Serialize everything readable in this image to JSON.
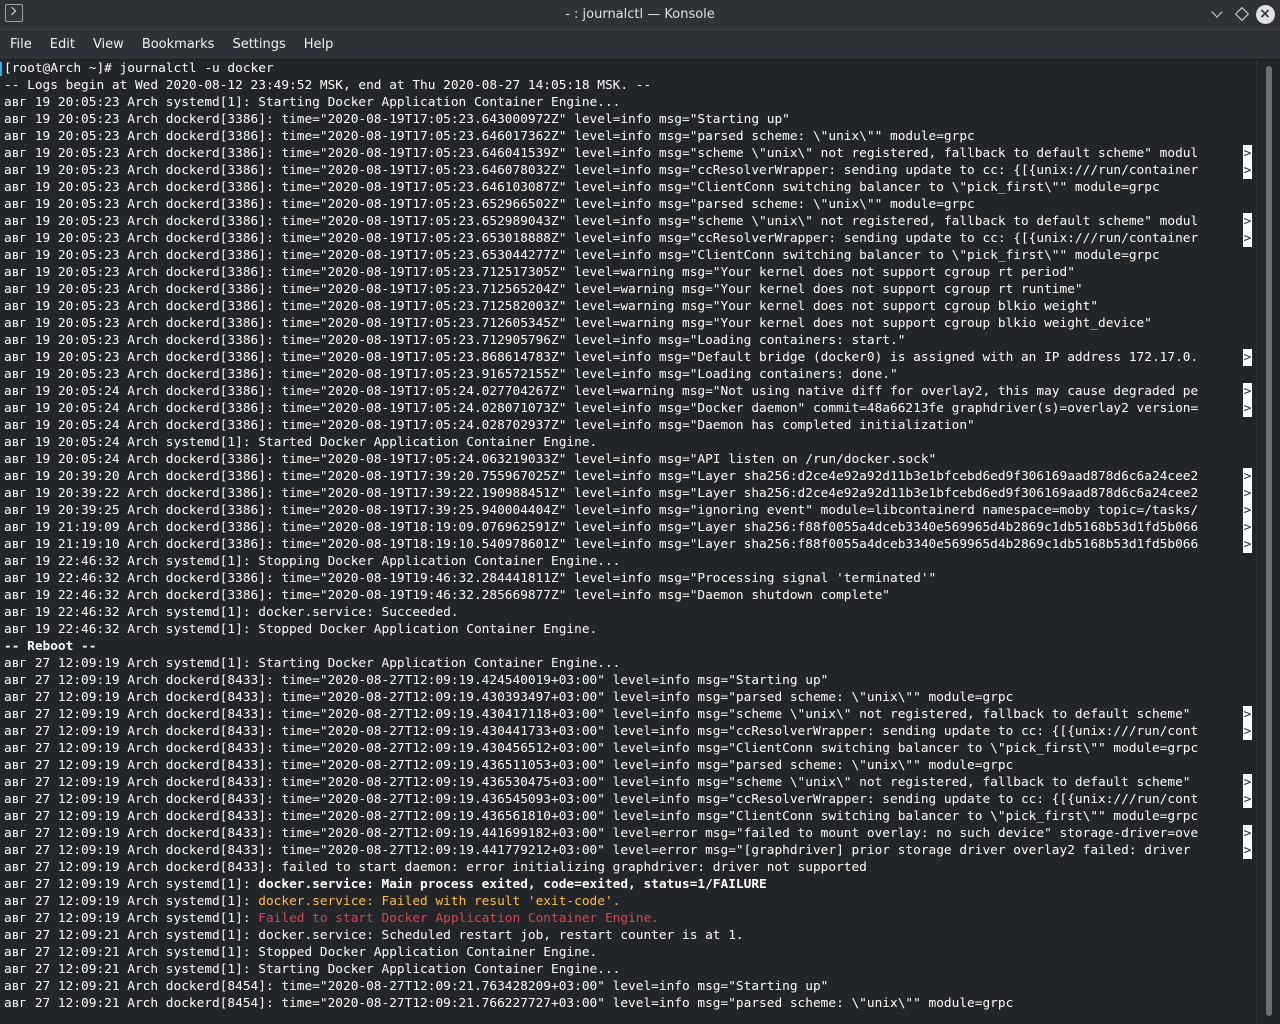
{
  "window": {
    "title": "- : journalctl — Konsole"
  },
  "menu": [
    "File",
    "Edit",
    "View",
    "Bookmarks",
    "Settings",
    "Help"
  ],
  "terminal": {
    "lines": [
      {
        "segments": [
          {
            "text": "[root@Arch ~]# journalctl -u docker"
          }
        ]
      },
      {
        "segments": [
          {
            "text": "-- Logs begin at Wed 2020-08-12 23:49:52 MSK, end at Thu 2020-08-27 14:05:18 MSK. --"
          }
        ]
      },
      {
        "segments": [
          {
            "text": "авг 19 20:05:23 Arch systemd[1]: Starting Docker Application Container Engine..."
          }
        ]
      },
      {
        "segments": [
          {
            "text": "авг 19 20:05:23 Arch dockerd[3386]: time=\"2020-08-19T17:05:23.643000972Z\" level=info msg=\"Starting up\""
          }
        ]
      },
      {
        "segments": [
          {
            "text": "авг 19 20:05:23 Arch dockerd[3386]: time=\"2020-08-19T17:05:23.646017362Z\" level=info msg=\"parsed scheme: \\\"unix\\\"\" module=grpc"
          }
        ]
      },
      {
        "segments": [
          {
            "text": "авг 19 20:05:23 Arch dockerd[3386]: time=\"2020-08-19T17:05:23.646041539Z\" level=info msg=\"scheme \\\"unix\\\" not registered, fallback to default scheme\" modul"
          }
        ],
        "truncated": true
      },
      {
        "segments": [
          {
            "text": "авг 19 20:05:23 Arch dockerd[3386]: time=\"2020-08-19T17:05:23.646078032Z\" level=info msg=\"ccResolverWrapper: sending update to cc: {[{unix:///run/container"
          }
        ],
        "truncated": true
      },
      {
        "segments": [
          {
            "text": "авг 19 20:05:23 Arch dockerd[3386]: time=\"2020-08-19T17:05:23.646103087Z\" level=info msg=\"ClientConn switching balancer to \\\"pick_first\\\"\" module=grpc"
          }
        ]
      },
      {
        "segments": [
          {
            "text": "авг 19 20:05:23 Arch dockerd[3386]: time=\"2020-08-19T17:05:23.652966502Z\" level=info msg=\"parsed scheme: \\\"unix\\\"\" module=grpc"
          }
        ]
      },
      {
        "segments": [
          {
            "text": "авг 19 20:05:23 Arch dockerd[3386]: time=\"2020-08-19T17:05:23.652989043Z\" level=info msg=\"scheme \\\"unix\\\" not registered, fallback to default scheme\" modul"
          }
        ],
        "truncated": true
      },
      {
        "segments": [
          {
            "text": "авг 19 20:05:23 Arch dockerd[3386]: time=\"2020-08-19T17:05:23.653018888Z\" level=info msg=\"ccResolverWrapper: sending update to cc: {[{unix:///run/container"
          }
        ],
        "truncated": true
      },
      {
        "segments": [
          {
            "text": "авг 19 20:05:23 Arch dockerd[3386]: time=\"2020-08-19T17:05:23.653044277Z\" level=info msg=\"ClientConn switching balancer to \\\"pick_first\\\"\" module=grpc"
          }
        ]
      },
      {
        "segments": [
          {
            "text": "авг 19 20:05:23 Arch dockerd[3386]: time=\"2020-08-19T17:05:23.712517305Z\" level=warning msg=\"Your kernel does not support cgroup rt period\""
          }
        ]
      },
      {
        "segments": [
          {
            "text": "авг 19 20:05:23 Arch dockerd[3386]: time=\"2020-08-19T17:05:23.712565204Z\" level=warning msg=\"Your kernel does not support cgroup rt runtime\""
          }
        ]
      },
      {
        "segments": [
          {
            "text": "авг 19 20:05:23 Arch dockerd[3386]: time=\"2020-08-19T17:05:23.712582003Z\" level=warning msg=\"Your kernel does not support cgroup blkio weight\""
          }
        ]
      },
      {
        "segments": [
          {
            "text": "авг 19 20:05:23 Arch dockerd[3386]: time=\"2020-08-19T17:05:23.712605345Z\" level=warning msg=\"Your kernel does not support cgroup blkio weight_device\""
          }
        ]
      },
      {
        "segments": [
          {
            "text": "авг 19 20:05:23 Arch dockerd[3386]: time=\"2020-08-19T17:05:23.712905796Z\" level=info msg=\"Loading containers: start.\""
          }
        ]
      },
      {
        "segments": [
          {
            "text": "авг 19 20:05:23 Arch dockerd[3386]: time=\"2020-08-19T17:05:23.868614783Z\" level=info msg=\"Default bridge (docker0) is assigned with an IP address 172.17.0."
          }
        ],
        "truncated": true
      },
      {
        "segments": [
          {
            "text": "авг 19 20:05:23 Arch dockerd[3386]: time=\"2020-08-19T17:05:23.916572155Z\" level=info msg=\"Loading containers: done.\""
          }
        ]
      },
      {
        "segments": [
          {
            "text": "авг 19 20:05:24 Arch dockerd[3386]: time=\"2020-08-19T17:05:24.027704267Z\" level=warning msg=\"Not using native diff for overlay2, this may cause degraded pe"
          }
        ],
        "truncated": true
      },
      {
        "segments": [
          {
            "text": "авг 19 20:05:24 Arch dockerd[3386]: time=\"2020-08-19T17:05:24.028071073Z\" level=info msg=\"Docker daemon\" commit=48a66213fe graphdriver(s)=overlay2 version="
          }
        ],
        "truncated": true
      },
      {
        "segments": [
          {
            "text": "авг 19 20:05:24 Arch dockerd[3386]: time=\"2020-08-19T17:05:24.028702937Z\" level=info msg=\"Daemon has completed initialization\""
          }
        ]
      },
      {
        "segments": [
          {
            "text": "авг 19 20:05:24 Arch systemd[1]: Started Docker Application Container Engine."
          }
        ]
      },
      {
        "segments": [
          {
            "text": "авг 19 20:05:24 Arch dockerd[3386]: time=\"2020-08-19T17:05:24.063219033Z\" level=info msg=\"API listen on /run/docker.sock\""
          }
        ]
      },
      {
        "segments": [
          {
            "text": "авг 19 20:39:20 Arch dockerd[3386]: time=\"2020-08-19T17:39:20.755967025Z\" level=info msg=\"Layer sha256:d2ce4e92a92d11b3e1bfcebd6ed9f306169aad878d6c6a24cee2"
          }
        ],
        "truncated": true
      },
      {
        "segments": [
          {
            "text": "авг 19 20:39:22 Arch dockerd[3386]: time=\"2020-08-19T17:39:22.190988451Z\" level=info msg=\"Layer sha256:d2ce4e92a92d11b3e1bfcebd6ed9f306169aad878d6c6a24cee2"
          }
        ],
        "truncated": true
      },
      {
        "segments": [
          {
            "text": "авг 19 20:39:25 Arch dockerd[3386]: time=\"2020-08-19T17:39:25.940004404Z\" level=info msg=\"ignoring event\" module=libcontainerd namespace=moby topic=/tasks/"
          }
        ],
        "truncated": true
      },
      {
        "segments": [
          {
            "text": "авг 19 21:19:09 Arch dockerd[3386]: time=\"2020-08-19T18:19:09.076962591Z\" level=info msg=\"Layer sha256:f88f0055a4dceb3340e569965d4b2869c1db5168b53d1fd5b066"
          }
        ],
        "truncated": true
      },
      {
        "segments": [
          {
            "text": "авг 19 21:19:10 Arch dockerd[3386]: time=\"2020-08-19T18:19:10.540978601Z\" level=info msg=\"Layer sha256:f88f0055a4dceb3340e569965d4b2869c1db5168b53d1fd5b066"
          }
        ],
        "truncated": true
      },
      {
        "segments": [
          {
            "text": "авг 19 22:46:32 Arch systemd[1]: Stopping Docker Application Container Engine..."
          }
        ]
      },
      {
        "segments": [
          {
            "text": "авг 19 22:46:32 Arch dockerd[3386]: time=\"2020-08-19T19:46:32.284441811Z\" level=info msg=\"Processing signal 'terminated'\""
          }
        ]
      },
      {
        "segments": [
          {
            "text": "авг 19 22:46:32 Arch dockerd[3386]: time=\"2020-08-19T19:46:32.285669877Z\" level=info msg=\"Daemon shutdown complete\""
          }
        ]
      },
      {
        "segments": [
          {
            "text": "авг 19 22:46:32 Arch systemd[1]: docker.service: Succeeded."
          }
        ]
      },
      {
        "segments": [
          {
            "text": "авг 19 22:46:32 Arch systemd[1]: Stopped Docker Application Container Engine."
          }
        ]
      },
      {
        "segments": [
          {
            "text": "-- Reboot --",
            "style": "bold"
          }
        ]
      },
      {
        "segments": [
          {
            "text": "авг 27 12:09:19 Arch systemd[1]: Starting Docker Application Container Engine..."
          }
        ]
      },
      {
        "segments": [
          {
            "text": "авг 27 12:09:19 Arch dockerd[8433]: time=\"2020-08-27T12:09:19.424540019+03:00\" level=info msg=\"Starting up\""
          }
        ]
      },
      {
        "segments": [
          {
            "text": "авг 27 12:09:19 Arch dockerd[8433]: time=\"2020-08-27T12:09:19.430393497+03:00\" level=info msg=\"parsed scheme: \\\"unix\\\"\" module=grpc"
          }
        ]
      },
      {
        "segments": [
          {
            "text": "авг 27 12:09:19 Arch dockerd[8433]: time=\"2020-08-27T12:09:19.430417118+03:00\" level=info msg=\"scheme \\\"unix\\\" not registered, fallback to default scheme\" "
          }
        ],
        "truncated": true
      },
      {
        "segments": [
          {
            "text": "авг 27 12:09:19 Arch dockerd[8433]: time=\"2020-08-27T12:09:19.430441733+03:00\" level=info msg=\"ccResolverWrapper: sending update to cc: {[{unix:///run/cont"
          }
        ],
        "truncated": true
      },
      {
        "segments": [
          {
            "text": "авг 27 12:09:19 Arch dockerd[8433]: time=\"2020-08-27T12:09:19.430456512+03:00\" level=info msg=\"ClientConn switching balancer to \\\"pick_first\\\"\" module=grpc"
          }
        ]
      },
      {
        "segments": [
          {
            "text": "авг 27 12:09:19 Arch dockerd[8433]: time=\"2020-08-27T12:09:19.436511053+03:00\" level=info msg=\"parsed scheme: \\\"unix\\\"\" module=grpc"
          }
        ]
      },
      {
        "segments": [
          {
            "text": "авг 27 12:09:19 Arch dockerd[8433]: time=\"2020-08-27T12:09:19.436530475+03:00\" level=info msg=\"scheme \\\"unix\\\" not registered, fallback to default scheme\" "
          }
        ],
        "truncated": true
      },
      {
        "segments": [
          {
            "text": "авг 27 12:09:19 Arch dockerd[8433]: time=\"2020-08-27T12:09:19.436545093+03:00\" level=info msg=\"ccResolverWrapper: sending update to cc: {[{unix:///run/cont"
          }
        ],
        "truncated": true
      },
      {
        "segments": [
          {
            "text": "авг 27 12:09:19 Arch dockerd[8433]: time=\"2020-08-27T12:09:19.436561810+03:00\" level=info msg=\"ClientConn switching balancer to \\\"pick_first\\\"\" module=grpc"
          }
        ]
      },
      {
        "segments": [
          {
            "text": "авг 27 12:09:19 Arch dockerd[8433]: time=\"2020-08-27T12:09:19.441699182+03:00\" level=error msg=\"failed to mount overlay: no such device\" storage-driver=ove"
          }
        ],
        "truncated": true
      },
      {
        "segments": [
          {
            "text": "авг 27 12:09:19 Arch dockerd[8433]: time=\"2020-08-27T12:09:19.441779212+03:00\" level=error msg=\"[graphdriver] prior storage driver overlay2 failed: driver "
          }
        ],
        "truncated": true
      },
      {
        "segments": [
          {
            "text": "авг 27 12:09:19 Arch dockerd[8433]: failed to start daemon: error initializing graphdriver: driver not supported"
          }
        ]
      },
      {
        "segments": [
          {
            "text": "авг 27 12:09:19 Arch systemd[1]: "
          },
          {
            "text": "docker.service: Main process exited, code=exited, status=1/FAILURE",
            "style": "bold"
          }
        ]
      },
      {
        "segments": [
          {
            "text": "авг 27 12:09:19 Arch systemd[1]: "
          },
          {
            "text": "docker.service: Failed with result 'exit-code'.",
            "style": "yellow"
          }
        ]
      },
      {
        "segments": [
          {
            "text": "авг 27 12:09:19 Arch systemd[1]: "
          },
          {
            "text": "Failed to start Docker Application Container Engine.",
            "style": "red"
          }
        ]
      },
      {
        "segments": [
          {
            "text": "авг 27 12:09:21 Arch systemd[1]: docker.service: Scheduled restart job, restart counter is at 1."
          }
        ]
      },
      {
        "segments": [
          {
            "text": "авг 27 12:09:21 Arch systemd[1]: Stopped Docker Application Container Engine."
          }
        ]
      },
      {
        "segments": [
          {
            "text": "авг 27 12:09:21 Arch systemd[1]: Starting Docker Application Container Engine..."
          }
        ]
      },
      {
        "segments": [
          {
            "text": "авг 27 12:09:21 Arch dockerd[8454]: time=\"2020-08-27T12:09:21.763428209+03:00\" level=info msg=\"Starting up\""
          }
        ]
      },
      {
        "segments": [
          {
            "text": "авг 27 12:09:21 Arch dockerd[8454]: time=\"2020-08-27T12:09:21.766227727+03:00\" level=info msg=\"parsed scheme: \\\"unix\\\"\" module=grpc"
          }
        ]
      }
    ],
    "truncation_marker": ">"
  },
  "colors": {
    "background": "#232629",
    "foreground": "#fcfcfc",
    "warning": "#fdbc4b",
    "error": "#da4453",
    "titlebar": "#2f3337"
  }
}
